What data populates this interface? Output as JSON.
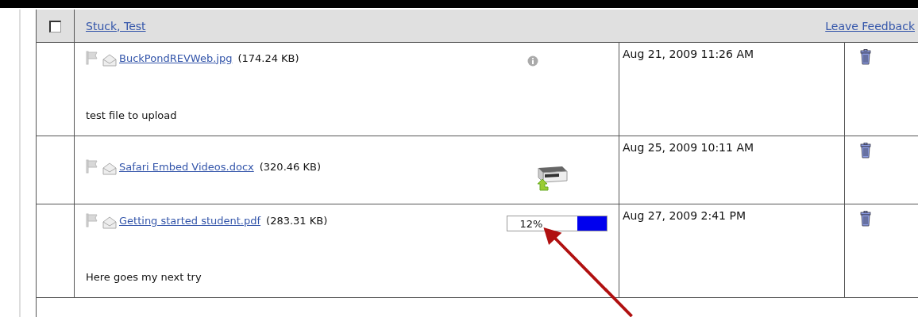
{
  "header": {
    "checkbox": {
      "checked": false
    },
    "name": "Stuck, Test",
    "feedback_link": "Leave Feedback"
  },
  "files": [
    {
      "kind": "info",
      "file_name": "BuckPondREVWeb.jpg",
      "size": "(174.24 KB)",
      "description": "test file to upload",
      "date": "Aug 21, 2009 11:26 AM"
    },
    {
      "kind": "transfer",
      "file_name": "Safari Embed Videos.docx",
      "size": "(320.46 KB)",
      "date": "Aug 25, 2009 10:11 AM"
    },
    {
      "kind": "progress",
      "file_name": "Getting started student.pdf",
      "size": "(283.31 KB)",
      "progress": {
        "reading": "12%",
        "level": 0.3
      },
      "description": "Here goes my next try",
      "date": "Aug 27, 2009 2:41 PM"
    }
  ]
}
